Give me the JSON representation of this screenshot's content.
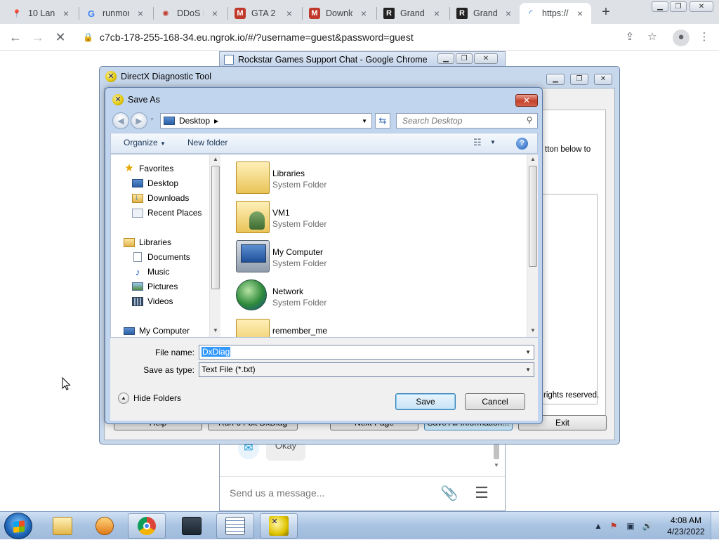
{
  "browser": {
    "tabs": [
      {
        "title": "10 Lant",
        "icon": "google-maps-icon"
      },
      {
        "title": "runmor",
        "icon": "google-icon"
      },
      {
        "title": "DDoS F",
        "icon": "web-icon"
      },
      {
        "title": "GTA 2 -",
        "icon": "shield-site-icon"
      },
      {
        "title": "Downlc",
        "icon": "shield-site-icon"
      },
      {
        "title": "Grand",
        "icon": "rockstar-icon"
      },
      {
        "title": "Grand",
        "icon": "rockstar-icon"
      },
      {
        "title": "https://",
        "icon": "loading-icon",
        "active": true
      }
    ],
    "url": "c7cb-178-255-168-34.eu.ngrok.io/#/?username=guest&password=guest"
  },
  "chat_window": {
    "title": "Rockstar Games Support Chat - Google Chrome",
    "bubble_text": "Okay",
    "input_placeholder": "Send us a message..."
  },
  "dxdiag": {
    "title": "DirectX Diagnostic Tool",
    "partial_text": "tton below to",
    "partial_copyright": "rights reserved.",
    "buttons": {
      "help": "Help",
      "run64": "Run 64-bit DxDiag",
      "next_page": "Next Page",
      "save_all": "Save All Information...",
      "exit": "Exit"
    }
  },
  "save_as": {
    "title": "Save As",
    "address": "Desktop",
    "search_placeholder": "Search Desktop",
    "toolbar": {
      "organize": "Organize",
      "new_folder": "New folder"
    },
    "nav": {
      "favorites": "Favorites",
      "desktop": "Desktop",
      "downloads": "Downloads",
      "recent_places": "Recent Places",
      "libraries": "Libraries",
      "documents": "Documents",
      "music": "Music",
      "pictures": "Pictures",
      "videos": "Videos",
      "my_computer": "My Computer"
    },
    "files": [
      {
        "name": "Libraries",
        "type": "System Folder"
      },
      {
        "name": "VM1",
        "type": "System Folder"
      },
      {
        "name": "My Computer",
        "type": "System Folder"
      },
      {
        "name": "Network",
        "type": "System Folder"
      },
      {
        "name": "remember_me",
        "type": ""
      }
    ],
    "file_name_label": "File name:",
    "file_name_value": "DxDiag",
    "save_type_label": "Save as type:",
    "save_type_value": "Text File (*.txt)",
    "hide_folders": "Hide Folders",
    "save_button": "Save",
    "cancel_button": "Cancel"
  },
  "taskbar": {
    "time": "4:08 AM",
    "date": "4/23/2022"
  },
  "colors": {
    "chrome_tabstrip": "#dee1e6",
    "aero_caption": "#c1d6ee",
    "selection": "#3399ff",
    "taskbar": "#a9c3e2"
  }
}
